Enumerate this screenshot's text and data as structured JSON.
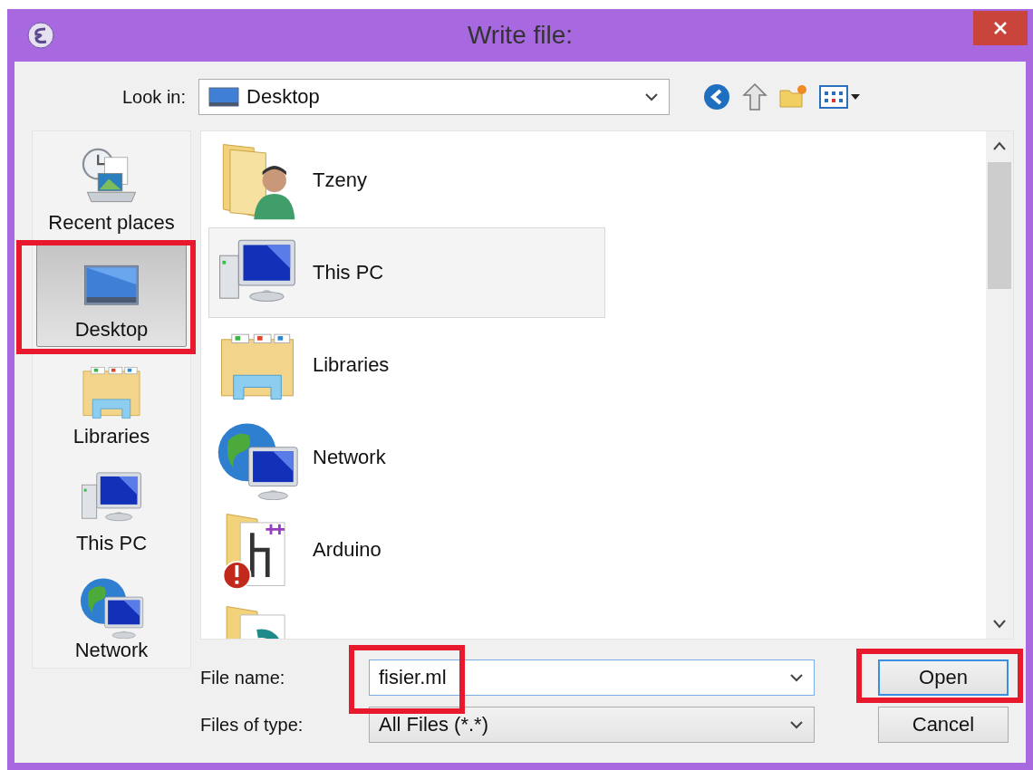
{
  "window": {
    "title": "Write file:"
  },
  "look_in": {
    "label": "Look in:",
    "value": "Desktop"
  },
  "places": [
    {
      "label": "Recent places",
      "kind": "recent",
      "selected": false,
      "highlighted": false
    },
    {
      "label": "Desktop",
      "kind": "desktop",
      "selected": true,
      "highlighted": true
    },
    {
      "label": "Libraries",
      "kind": "libraries",
      "selected": false,
      "highlighted": false
    },
    {
      "label": "This PC",
      "kind": "computer",
      "selected": false,
      "highlighted": false
    },
    {
      "label": "Network",
      "kind": "network",
      "selected": false,
      "highlighted": false
    }
  ],
  "files": [
    {
      "name": "Tzeny",
      "kind": "user-folder",
      "hovered": false
    },
    {
      "name": "This PC",
      "kind": "computer",
      "hovered": true
    },
    {
      "name": "Libraries",
      "kind": "libraries",
      "hovered": false
    },
    {
      "name": "Network",
      "kind": "network",
      "hovered": false
    },
    {
      "name": "Arduino",
      "kind": "app-folder",
      "hovered": false
    },
    {
      "kind": "folder",
      "hovered": false
    }
  ],
  "file_name": {
    "label": "File name:",
    "value": "fisier.ml",
    "highlighted": true
  },
  "file_type": {
    "label": "Files of type:",
    "value": "All Files (*.*)"
  },
  "buttons": [
    {
      "label": "Open",
      "default": true,
      "highlighted": true
    },
    {
      "label": "Cancel",
      "default": false,
      "highlighted": false
    }
  ]
}
